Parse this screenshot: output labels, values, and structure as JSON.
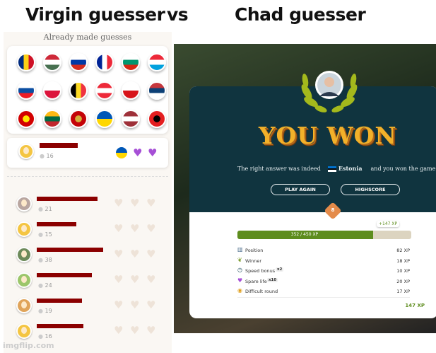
{
  "titles": {
    "left": "Virgin guesser",
    "vs": "vs",
    "right": "Chad guesser"
  },
  "left": {
    "header": "Already made guesses",
    "flags": [
      {
        "name": "romania-flag",
        "colors": [
          "#002b7f",
          "#fcd116",
          "#ce1126"
        ],
        "dir": "v"
      },
      {
        "name": "hungary-flag",
        "colors": [
          "#ce2939",
          "#ffffff",
          "#477050"
        ],
        "dir": "h"
      },
      {
        "name": "russia-flag",
        "colors": [
          "#ffffff",
          "#0039a6",
          "#d52b1e"
        ],
        "dir": "h"
      },
      {
        "name": "france-flag",
        "colors": [
          "#002395",
          "#ffffff",
          "#ed2939"
        ],
        "dir": "v"
      },
      {
        "name": "bulgaria-flag",
        "colors": [
          "#ffffff",
          "#00966e",
          "#d62612"
        ],
        "dir": "h"
      },
      {
        "name": "luxembourg-flag",
        "colors": [
          "#ed2939",
          "#ffffff",
          "#00a1de"
        ],
        "dir": "h"
      },
      {
        "name": "slovakia-flag",
        "colors": [
          "#ffffff",
          "#0b4ea2",
          "#ee1c25"
        ],
        "dir": "h"
      },
      {
        "name": "poland-flag",
        "colors": [
          "#ffffff",
          "#dc143c"
        ],
        "dir": "h"
      },
      {
        "name": "belgium-flag",
        "colors": [
          "#000000",
          "#fdda24",
          "#ef3340"
        ],
        "dir": "v"
      },
      {
        "name": "austria-flag",
        "colors": [
          "#ed2939",
          "#ffffff",
          "#ed2939"
        ],
        "dir": "h"
      },
      {
        "name": "czechia-flag",
        "colors": [
          "#ffffff",
          "#d7141a"
        ],
        "dir": "h"
      },
      {
        "name": "serbia-flag",
        "colors": [
          "#c6363c",
          "#0c4076",
          "#ffffff"
        ],
        "dir": "h"
      },
      {
        "name": "north-macedonia-flag",
        "colors": [
          "#d20000",
          "#ffe600"
        ],
        "dir": "sun"
      },
      {
        "name": "lithuania-flag",
        "colors": [
          "#fdb913",
          "#006a44",
          "#c1272d"
        ],
        "dir": "h"
      },
      {
        "name": "montenegro-flag",
        "colors": [
          "#c40308",
          "#d3ae3b"
        ],
        "dir": "sun"
      },
      {
        "name": "ukraine-flag",
        "colors": [
          "#0057b7",
          "#ffd700"
        ],
        "dir": "h"
      },
      {
        "name": "latvia-flag",
        "colors": [
          "#9e3039",
          "#ffffff",
          "#9e3039"
        ],
        "dir": "h"
      },
      {
        "name": "albania-flag",
        "colors": [
          "#e41e20",
          "#000000"
        ],
        "dir": "sun"
      }
    ],
    "me": {
      "score": "16"
    },
    "players": [
      {
        "score": "21"
      },
      {
        "score": "15"
      },
      {
        "score": "38"
      },
      {
        "score": "24"
      },
      {
        "score": "19"
      },
      {
        "score": "16"
      }
    ],
    "heart_icon": "heart-icon"
  },
  "right": {
    "headline": "YOU WON",
    "result_prefix": "The right answer was indeed",
    "country": "Estonia",
    "result_suffix": "and you won the game!",
    "play_again": "PLAY AGAIN",
    "highscore": "HIGHSCORE",
    "level": "8",
    "xp_progress": "352 / 450 XP",
    "xp_fraction": 0.782,
    "xp_gain": "+147 XP",
    "rows": [
      {
        "icon": "position-icon",
        "label": "Position",
        "mult": "",
        "value": "82 XP"
      },
      {
        "icon": "winner-icon",
        "label": "Winner",
        "mult": "",
        "value": "18 XP"
      },
      {
        "icon": "speed-icon",
        "label": "Speed bonus",
        "mult": "x2",
        "value": "10 XP"
      },
      {
        "icon": "heart-icon",
        "label": "Spare life",
        "mult": "x10",
        "value": "20 XP"
      },
      {
        "icon": "difficult-icon",
        "label": "Difficult round",
        "mult": "",
        "value": "17 XP"
      }
    ],
    "total": "147 XP",
    "colors": {
      "accent": "#5e8d1e",
      "headline": "#f2b12a",
      "card_top": "#10343f"
    }
  },
  "watermark": "imgflip.com"
}
